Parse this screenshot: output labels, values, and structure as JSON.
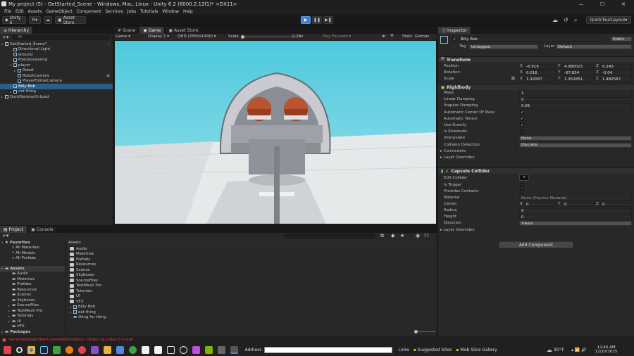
{
  "window": {
    "title": "My project (5) - GetStarted_Scene - Windows, Mac, Linux - Unity 6.2 (6000.2.12f1)* <DX11>",
    "minimize": "—",
    "maximize": "☐",
    "close": "✕"
  },
  "menu": [
    "File",
    "Edit",
    "Assets",
    "GameObject",
    "Component",
    "Services",
    "Jobs",
    "Tutorials",
    "Window",
    "Help"
  ],
  "toolbar": {
    "account": "Unity 6",
    "user": "R",
    "asset_store": "Asset Store",
    "layout": "QuickTourLayout"
  },
  "hierarchy": {
    "tab": "Hierarchy",
    "search": "All",
    "items": [
      {
        "label": "GetStarted_Scene*",
        "indent": 0,
        "expanded": true,
        "scene": true
      },
      {
        "label": "Directional Light",
        "indent": 2
      },
      {
        "label": "Ground",
        "indent": 2
      },
      {
        "label": "Postprocessing",
        "indent": 2
      },
      {
        "label": "player",
        "indent": 2,
        "expanded": true
      },
      {
        "label": "Robot",
        "indent": 3,
        "collapsed": true
      },
      {
        "label": "RobotCamera",
        "indent": 3,
        "eye": true
      },
      {
        "label": "PlayerFollowCamera",
        "indent": 3
      },
      {
        "label": "Billy Bob",
        "indent": 2,
        "collapsed": true,
        "selected": true
      },
      {
        "label": "dat thing",
        "indent": 2,
        "collapsed": true
      },
      {
        "label": "DontDestroyOnLoad",
        "indent": 0,
        "collapsed": true,
        "scene": true
      }
    ]
  },
  "view_tabs": [
    "Scene",
    "Game",
    "Asset Store"
  ],
  "game_bar": {
    "mode": "Game",
    "display": "Display 1",
    "resolution": "QHD (2560x1440)",
    "scale_label": "Scale",
    "scale_value": "0.28x",
    "focus": "Play Focused",
    "stats": "Stats",
    "gizmos": "Gizmos"
  },
  "inspector": {
    "tab": "Inspector",
    "name": "Billy Bob",
    "static": "Static",
    "tag_label": "Tag",
    "tag": "Untagged",
    "layer_label": "Layer",
    "layer": "Default",
    "transform": {
      "title": "Transform",
      "rows": [
        {
          "label": "Position",
          "x": "-6.919",
          "y": "4.980015",
          "z": "0.243"
        },
        {
          "label": "Rotation",
          "x": "0.016",
          "y": "-67.854",
          "z": "-0.04"
        },
        {
          "label": "Scale",
          "x": "1.32087",
          "y": "1.352851",
          "z": "1.482567"
        }
      ]
    },
    "rigidbody": {
      "title": "Rigidbody",
      "rows": [
        {
          "label": "Mass",
          "value": "1"
        },
        {
          "label": "Linear Damping",
          "value": "0"
        },
        {
          "label": "Angular Damping",
          "value": "0.05"
        },
        {
          "label": "Automatic Center Of Mass",
          "check": true
        },
        {
          "label": "Automatic Tensor",
          "check": true
        },
        {
          "label": "Use Gravity",
          "check": true
        },
        {
          "label": "Is Kinematic",
          "check": false
        },
        {
          "label": "Interpolate",
          "dropdown": "None"
        },
        {
          "label": "Collision Detection",
          "dropdown": "Discrete"
        }
      ],
      "foldouts": [
        "Constraints",
        "Layer Overrides"
      ]
    },
    "capsule": {
      "title": "Capsule Collider",
      "edit_label": "Edit Collider",
      "rows": [
        {
          "label": "Is Trigger",
          "check": false
        },
        {
          "label": "Provides Contacts",
          "check": false
        },
        {
          "label": "Material",
          "value": "None (Physics Material)"
        }
      ],
      "center": {
        "label": "Center",
        "x": "0",
        "y": "0",
        "z": "0"
      },
      "radius": {
        "label": "Radius",
        "value": "0"
      },
      "height": {
        "label": "Height",
        "value": "0"
      },
      "direction": {
        "label": "Direction",
        "value": "Y-Axis"
      },
      "foldout": "Layer Overrides"
    },
    "add_component": "Add Component"
  },
  "project": {
    "tabs": [
      "Project",
      "Console"
    ],
    "badge": "21",
    "favorites": {
      "label": "Favorites",
      "items": [
        "All Materials",
        "All Models",
        "All Prefabs"
      ]
    },
    "assets_tree": {
      "label": "Assets",
      "items": [
        "Audio",
        "Materials",
        "Prefabs",
        "Resources",
        "Scenes",
        "Skyboxes",
        "SourceFiles",
        "TextMesh Pro",
        "Tutorials",
        "UI",
        "VFX"
      ]
    },
    "packages": "Packages",
    "breadcrumb": "Assets",
    "files": [
      {
        "name": "Audio",
        "type": "folder"
      },
      {
        "name": "Materials",
        "type": "folder"
      },
      {
        "name": "Prefabs",
        "type": "folder"
      },
      {
        "name": "Resources",
        "type": "folder"
      },
      {
        "name": "Scenes",
        "type": "folder"
      },
      {
        "name": "Skyboxes",
        "type": "folder"
      },
      {
        "name": "SourceFiles",
        "type": "folder"
      },
      {
        "name": "TextMesh Pro",
        "type": "folder"
      },
      {
        "name": "Tutorials",
        "type": "folder"
      },
      {
        "name": "UI",
        "type": "folder"
      },
      {
        "name": "VFX",
        "type": "folder"
      },
      {
        "name": "Billy Bob",
        "type": "prefab"
      },
      {
        "name": "dat thing",
        "type": "prefab"
      },
      {
        "name": "thing for thing",
        "type": "script"
      }
    ]
  },
  "status": {
    "error": "SerializedObjectNotCreatableException: Object at index 0 is null"
  },
  "taskbar": {
    "address_label": "Address",
    "links": "Links",
    "suggested": "Suggested Sites",
    "gallery": "Web Slice Gallery",
    "temp": "30°F",
    "time": "12:46 AM",
    "date": "12/10/2025"
  },
  "colors": {
    "sky": "#4fc9dd",
    "ground": "#e7e9ea",
    "error": "#e04040",
    "selected": "#2c5d87",
    "accent": "#3d7fd6"
  }
}
